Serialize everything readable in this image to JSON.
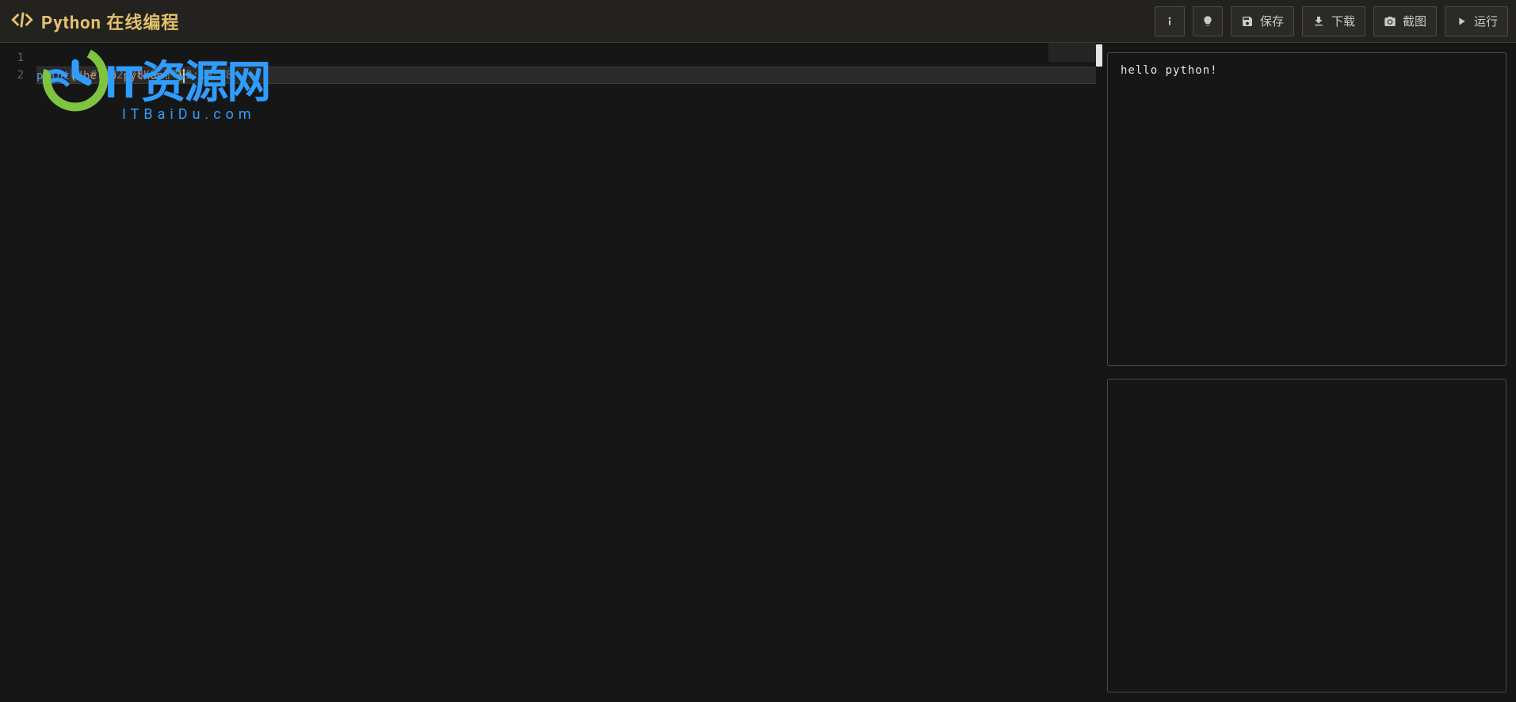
{
  "header": {
    "title": "Python  在线编程",
    "buttons": {
      "info": "",
      "theme": "",
      "save": "保存",
      "download": "下载",
      "screenshot": "截图",
      "run": "运行"
    }
  },
  "editor": {
    "lines": [
      {
        "number": "1",
        "content": "# 2021/8/8 下午2:19:18",
        "type": "comment"
      },
      {
        "number": "2",
        "content_keyword": "print",
        "content_open": "(",
        "content_string": "\"hello python!\"",
        "content_close": ")",
        "type": "call"
      }
    ]
  },
  "output": {
    "stdout": "hello python!",
    "extra": ""
  },
  "watermark": {
    "main": "IT资源网",
    "sub": "ITBaiDu.com"
  }
}
